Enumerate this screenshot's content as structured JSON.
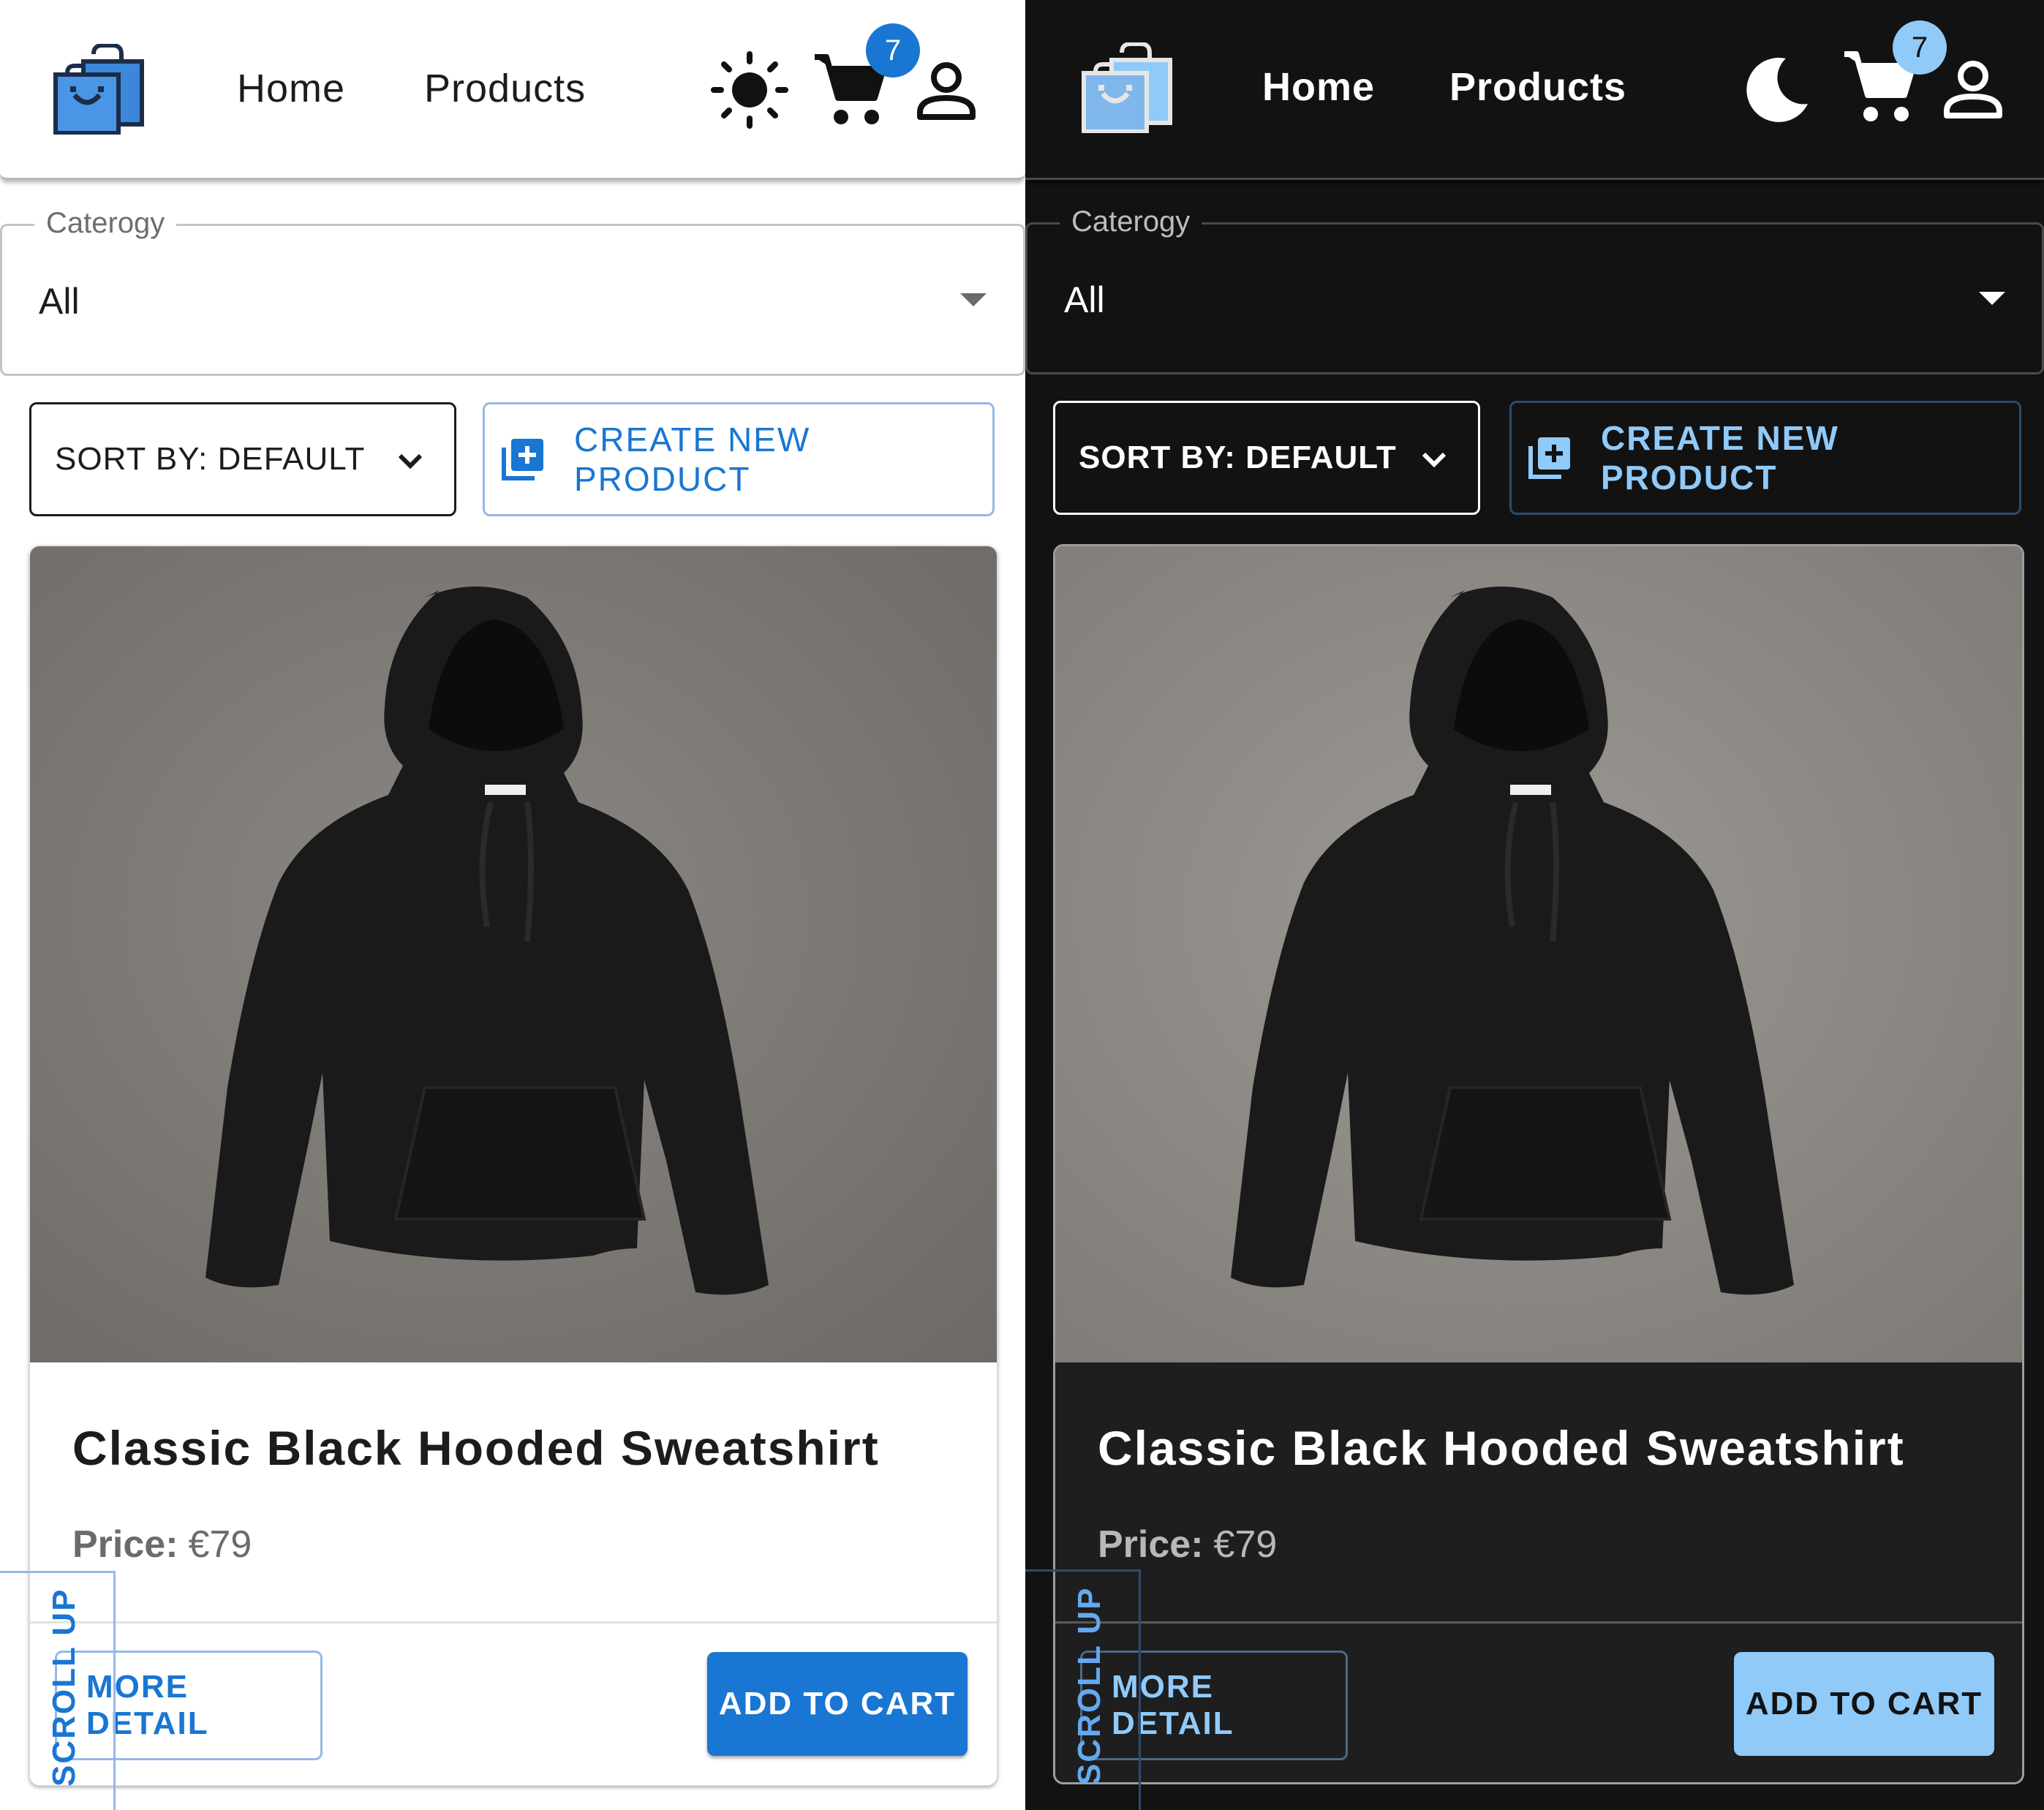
{
  "nav": {
    "home": "Home",
    "products": "Products",
    "cart_count": "7"
  },
  "filter": {
    "category_label": "Caterogy",
    "category_value": "All"
  },
  "toolbar": {
    "sort_label": "SORT BY: DEFAULT",
    "create_label": "CREATE NEW PRODUCT"
  },
  "product": {
    "title": "Classic Black Hooded Sweatshirt",
    "price_label": "Price:",
    "price_value": "€79",
    "more_label": "MORE DETAIL",
    "cart_label": "ADD TO CART"
  },
  "scroll": {
    "label": "SCROLL UP"
  },
  "themes": {
    "light": {
      "accent": "#1976d2",
      "background": "#ffffff",
      "theme_icon": "sun-icon"
    },
    "dark": {
      "accent": "#90caf9",
      "background": "#121212",
      "theme_icon": "moon-icon"
    }
  }
}
